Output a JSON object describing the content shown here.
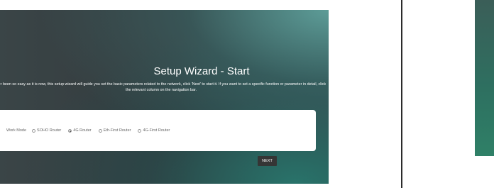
{
  "wizard": {
    "title": "Setup Wizard - Start",
    "description": "ver been so easy as it is now, this setup wizard will guide you set the basic parameters related to the network, click 'Next' to start it. If you want to set a specific function or parameter in detail, click the relevant column on the navigation bar.",
    "work_mode": {
      "label": "Work Mode",
      "options": [
        {
          "label": "SOHO Router",
          "selected": false
        },
        {
          "label": "4G Router",
          "selected": true
        },
        {
          "label": "Eth-First Router",
          "selected": false
        },
        {
          "label": "4G-First Router",
          "selected": false
        }
      ]
    },
    "next_label": "NEXT"
  }
}
